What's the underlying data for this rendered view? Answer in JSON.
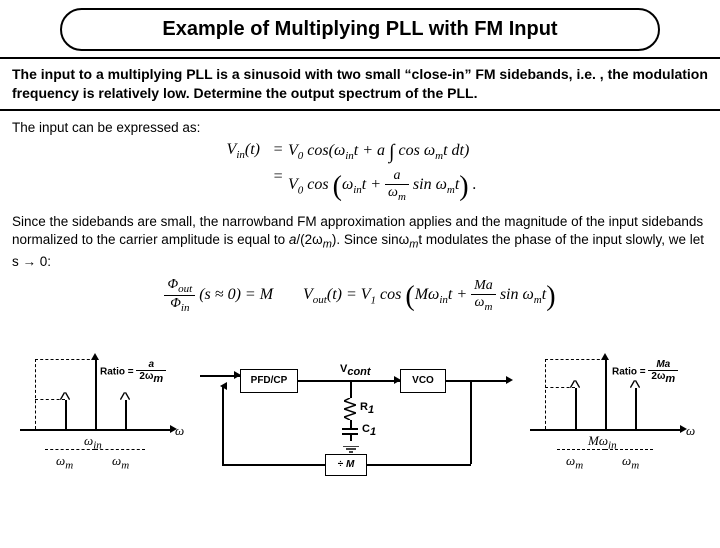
{
  "title": "Example of Multiplying PLL with FM Input",
  "problem": "The input to a multiplying PLL is a sinusoid with two small “close-in” FM sidebands, i.e. , the modulation frequency is relatively low. Determine the output spectrum of the PLL.",
  "line1": "The input can be expressed as:",
  "eq1": {
    "lhs": "V_{in}(t)",
    "rhs_a": "V_0 cos(ω_{in}t + a ∫ cosω_m t dt)",
    "rhs_b": "V_0 cos(ω_{in}t + (a/ω_m) sinω_m t) ."
  },
  "line2_parts": {
    "a": "Since the sidebands are small, the narrowband FM approximation applies and the magnitude of the input sidebands normalized to the carrier amplitude is equal to ",
    "b": "a",
    "c": "/(2ω",
    "d": "m",
    "e": "). Since sinω",
    "f": "m",
    "g": "t modulates the phase of the input slowly, we let s → 0:"
  },
  "eq2": {
    "lhs_num": "Φ_{out}",
    "lhs_den": "Φ_{in}",
    "arg": "(s ≈ 0) = M",
    "rhs": "V_{out}(t) = V_1 cos(Mω_{in}t + (Ma/ω_m) sinω_m t)"
  },
  "diagram": {
    "ratio_in": {
      "label": "Ratio =",
      "num": "a",
      "den": "2ω_m"
    },
    "ratio_out": {
      "label": "Ratio =",
      "num": "Ma",
      "den": "2ω_m"
    },
    "axis_in": {
      "center": "ω_{in}",
      "side": "ω_m",
      "xend": "ω"
    },
    "axis_out": {
      "center": "Mω_{in}",
      "side": "ω_m",
      "xend": "ω"
    },
    "blocks": {
      "pfd": "PFD/CP",
      "vco": "VCO",
      "div": "÷ M",
      "r1": "R_1",
      "c1": "C_1",
      "vcont": "V_{cont}"
    }
  }
}
